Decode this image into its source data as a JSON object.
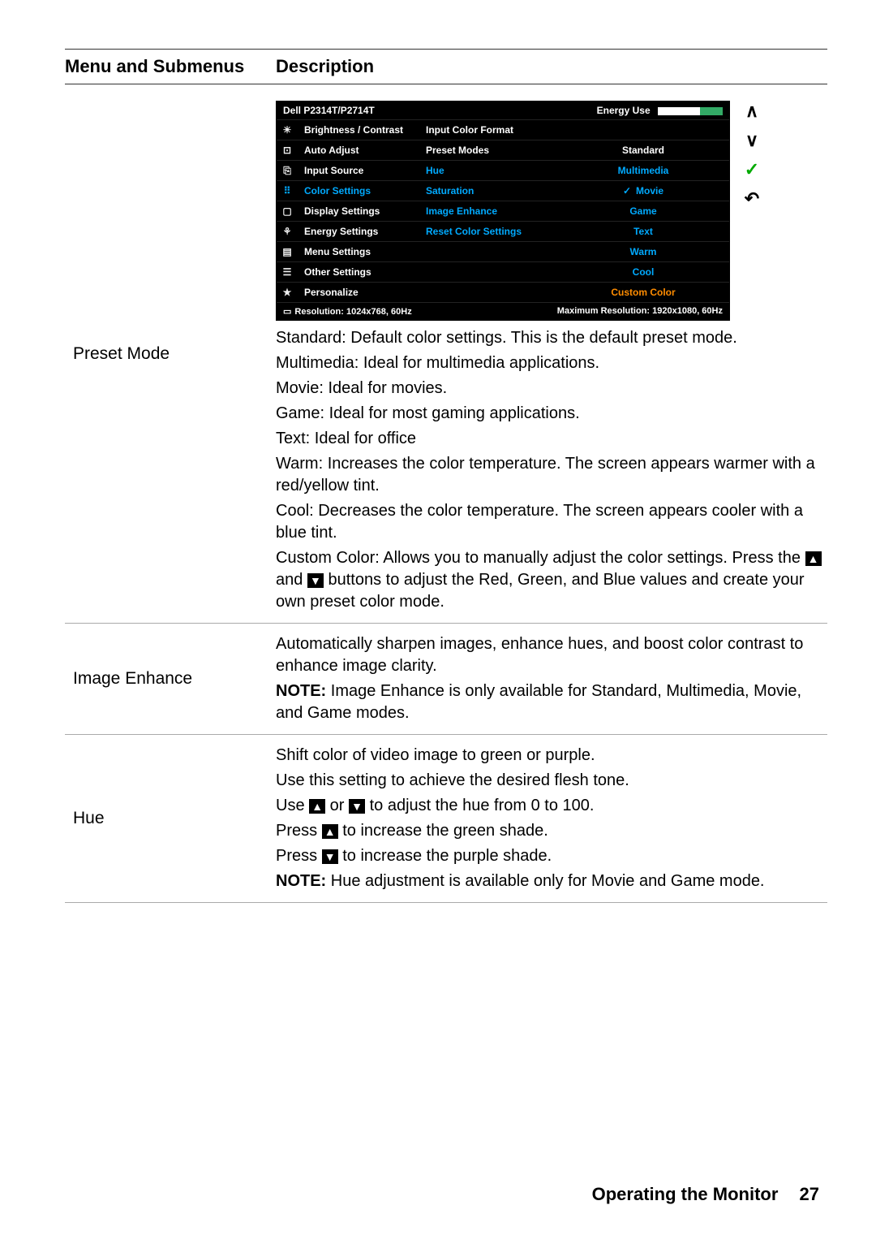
{
  "header": {
    "left": "Menu and Submenus",
    "right": "Description"
  },
  "osd": {
    "model": "Dell P2314T/P2714T",
    "energy_label": "Energy Use",
    "main_menu": [
      "Brightness / Contrast",
      "Auto Adjust",
      "Input Source",
      "Color Settings",
      "Display Settings",
      "Energy Settings",
      "Menu Settings",
      "Other Settings",
      "Personalize"
    ],
    "sub_menu": [
      "Input Color Format",
      "Preset Modes",
      "Hue",
      "Saturation",
      "Image Enhance",
      "Reset Color Settings"
    ],
    "presets": [
      "Standard",
      "Multimedia",
      "Movie",
      "Game",
      "Text",
      "Warm",
      "Cool",
      "Custom Color"
    ],
    "selected_preset_index": 2,
    "resolution_label": "Resolution:  1024x768, 60Hz",
    "max_resolution_label": "Maximum Resolution: 1920x1080, 60Hz"
  },
  "rows": {
    "preset": {
      "title": "Preset Mode",
      "lines": [
        "Standard: Default color settings. This is the default preset mode.",
        "Multimedia: Ideal for multimedia applications.",
        "Movie: Ideal for movies.",
        "Game: Ideal for most gaming applications.",
        "Text: Ideal for office",
        "Warm: Increases the color temperature. The screen appears warmer with a red/yellow tint.",
        "Cool: Decreases the color temperature. The screen appears cooler with a blue tint."
      ],
      "custom_prefix": "Custom Color: Allows you to manually adjust the color settings. Press the ",
      "custom_mid": " and ",
      "custom_suffix": " buttons to adjust the Red, Green, and Blue values and create your own preset color mode."
    },
    "image_enhance": {
      "title": "Image Enhance",
      "line1": "Automatically sharpen images, enhance hues, and boost color contrast to enhance image clarity.",
      "note_label": "NOTE:",
      "note_text": " Image Enhance is only available for Standard, Multimedia, Movie, and Game modes."
    },
    "hue": {
      "title": "Hue",
      "l1": "Shift color of video image to green or purple.",
      "l2": "Use this setting to achieve the desired flesh tone.",
      "l3a": "Use ",
      "l3b": " or ",
      "l3c": " to adjust the hue from 0 to 100.",
      "l4a": "Press ",
      "l4b": " to increase the green shade.",
      "l5a": "Press ",
      "l5b": " to increase the purple shade.",
      "note_label": "NOTE:",
      "note_text": " Hue adjustment is available only for Movie and Game mode."
    }
  },
  "footer": {
    "title": "Operating the Monitor",
    "page": "27"
  },
  "icons": {
    "up": "▲",
    "down": "▼"
  }
}
